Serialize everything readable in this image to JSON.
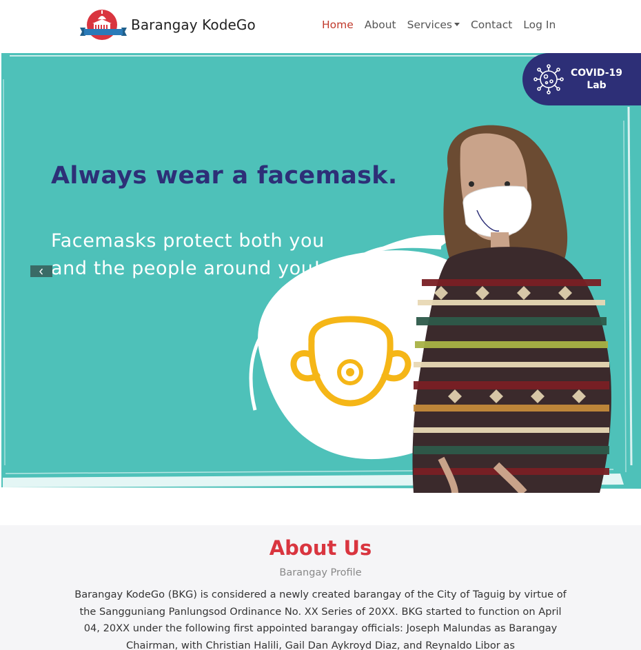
{
  "brand": {
    "name": "Barangay KodeGo",
    "logo_icon": "capitol-building-icon"
  },
  "nav": {
    "home": "Home",
    "about": "About",
    "services": "Services",
    "contact": "Contact",
    "login": "Log In",
    "active_color": "#c0392b"
  },
  "hero": {
    "title": "Always wear a facemask.",
    "subtitle_line1": "Facemasks protect both you",
    "subtitle_line2": "and the people around you!",
    "background_color": "#4ec1b9",
    "title_color": "#2d2f77"
  },
  "covid_badge": {
    "line1": "COVID-19",
    "line2": "Lab",
    "icon": "virus-icon",
    "color": "#2d2f77"
  },
  "about": {
    "title": "About Us",
    "subtitle": "Barangay Profile",
    "body": "Barangay KodeGo (BKG) is considered a newly created barangay of the City of Taguig by virtue of the Sangguniang Panlungsod Ordinance No. XX Series of 20XX. BKG started to function on April 04, 20XX under the following first appointed barangay officials: Joseph Malundas as Barangay Chairman, with Christian Halili, Gail Dan Aykroyd Diaz, and Reynaldo Libor as",
    "title_color": "#d9353f"
  }
}
